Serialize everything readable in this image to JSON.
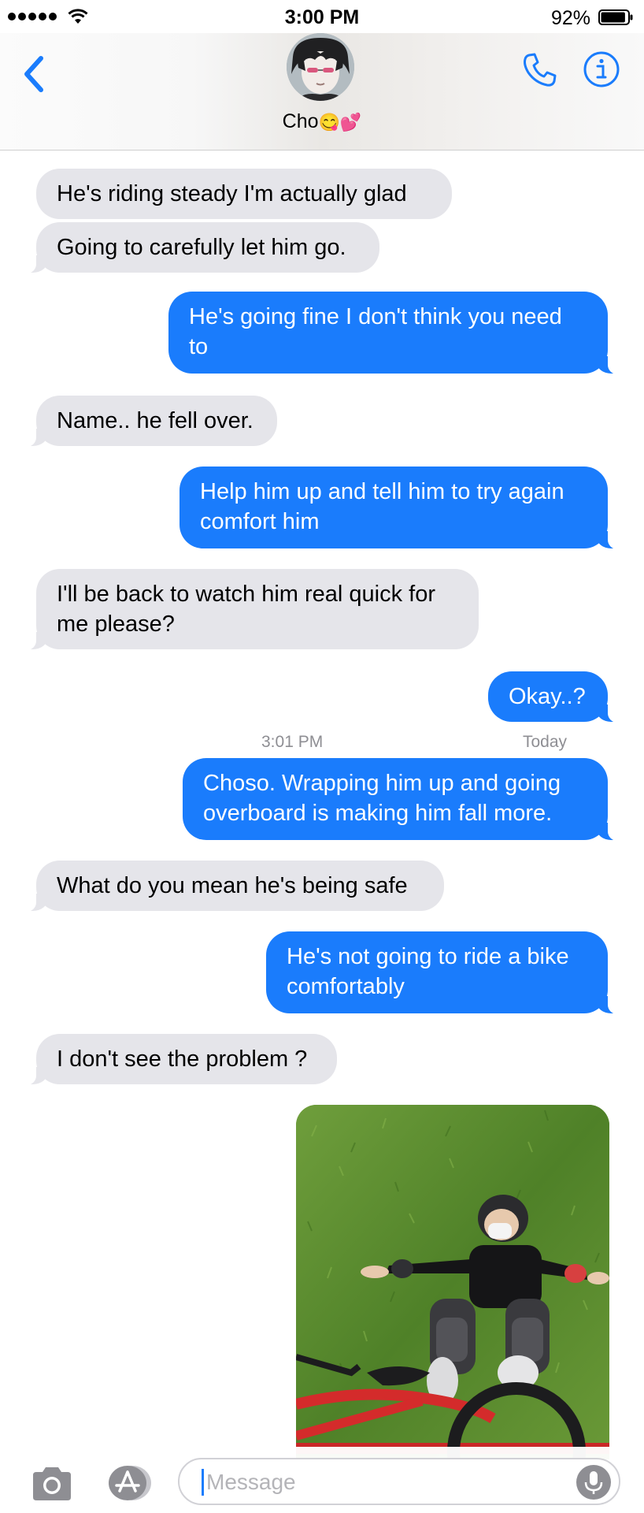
{
  "status_bar": {
    "time": "3:00 PM",
    "battery_percent": "92%",
    "battery_level": 0.92,
    "signal_icon": "signal-dots-icon",
    "wifi_icon": "wifi-icon",
    "battery_icon": "battery-icon"
  },
  "header": {
    "contact_name": "Cho",
    "contact_emoji": "😋💕",
    "back_icon": "chevron-left-icon",
    "call_icon": "phone-icon",
    "info_icon": "info-icon",
    "accent_color": "#1a7cfc"
  },
  "messages": [
    {
      "direction": "incoming",
      "text": "He's riding steady I'm actually glad"
    },
    {
      "direction": "incoming",
      "text": "Going to carefully let him go."
    },
    {
      "direction": "outgoing",
      "text": "He's going fine I don't think you need to"
    },
    {
      "direction": "incoming",
      "text": "Name.. he fell over."
    },
    {
      "direction": "outgoing",
      "text": "Help him up and tell him to try again comfort him"
    },
    {
      "direction": "incoming",
      "text": "I'll be back to watch him real quick for me please?"
    },
    {
      "direction": "outgoing",
      "text": "Okay..?"
    },
    {
      "direction": "outgoing",
      "text": "Choso. Wrapping him up and going overboard is making him fall more."
    },
    {
      "direction": "incoming",
      "text": "What do you mean he's being safe"
    },
    {
      "direction": "outgoing",
      "text": "He's not going to ride a bike comfortably"
    },
    {
      "direction": "incoming",
      "text": "I don't see the problem ?"
    }
  ],
  "timestamp": {
    "day": "Today",
    "time": "3:01 PM"
  },
  "photo_message": {
    "direction": "outgoing",
    "icon": "photo-attachment"
  },
  "input_bar": {
    "placeholder": "Message",
    "camera_icon": "camera-icon",
    "apps_icon": "app-store-icon",
    "mic_icon": "microphone-icon"
  },
  "colors": {
    "incoming_bubble": "#e5e5ea",
    "outgoing_bubble": "#1a7cfc",
    "timestamp_text": "#8e8e93"
  }
}
